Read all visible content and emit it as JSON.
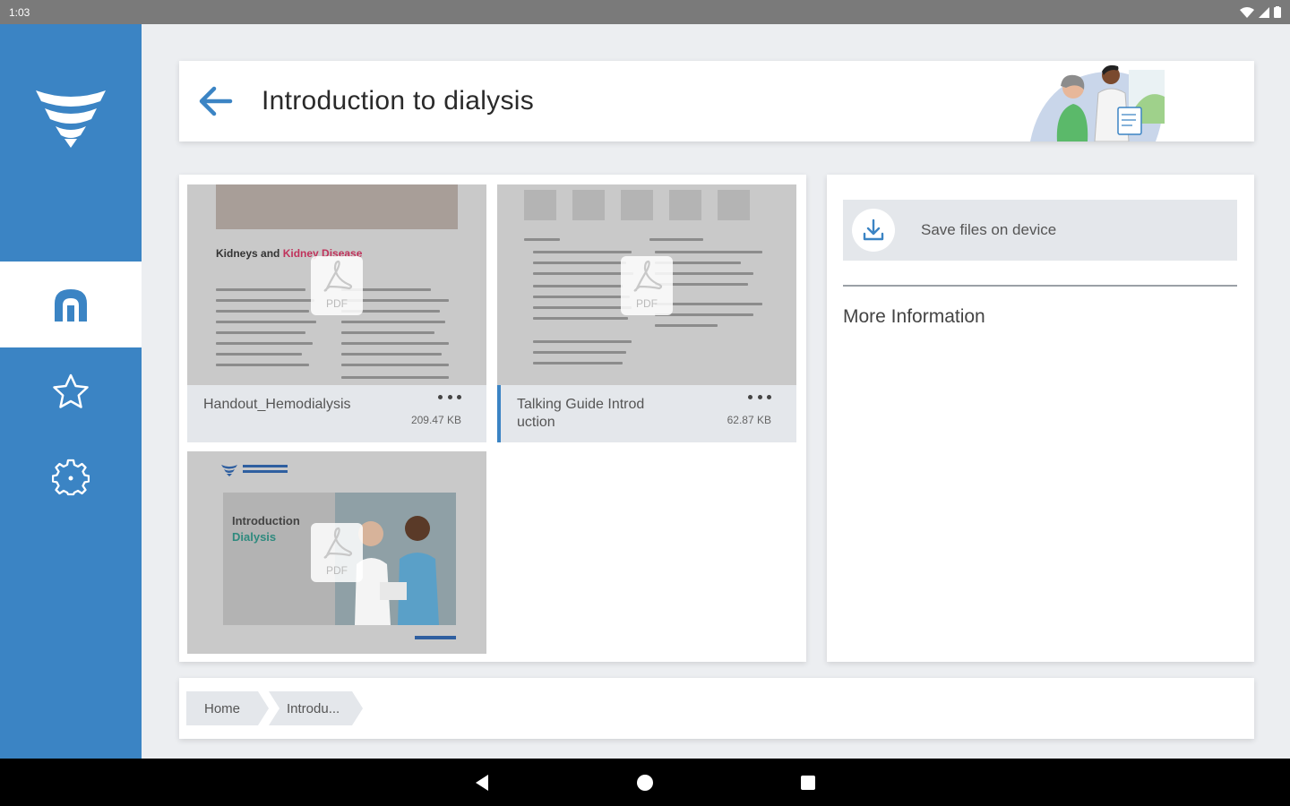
{
  "status_bar": {
    "time": "1:03"
  },
  "header": {
    "title": "Introduction to dialysis"
  },
  "files": [
    {
      "name": "Handout_Hemodialysis",
      "size": "209.47 KB",
      "badge": "PDF",
      "thumb_heading_a": "Kidneys and ",
      "thumb_heading_b": "Kidney Disease"
    },
    {
      "name": "Talking Guide Introduction",
      "size": "62.87 KB",
      "badge": "PDF"
    },
    {
      "name": "",
      "size": "",
      "badge": "PDF",
      "thumb_title_a": "Introduction",
      "thumb_title_b": "Dialysis"
    }
  ],
  "info": {
    "save_label": "Save files on device",
    "more_info": "More Information"
  },
  "breadcrumb": {
    "home": "Home",
    "current": "Introdu..."
  },
  "colors": {
    "brand": "#3b84c4",
    "sidebar": "#3b84c4",
    "tile": "#dde0e4"
  }
}
